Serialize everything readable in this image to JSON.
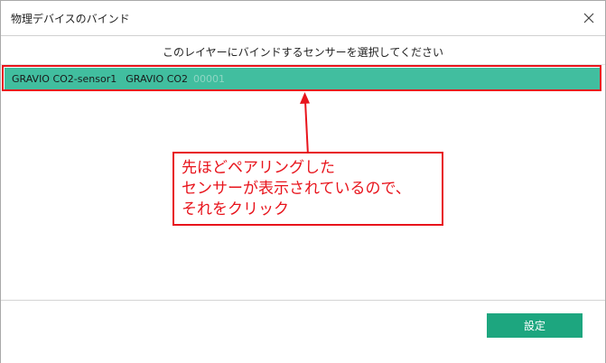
{
  "dialog": {
    "title": "物理デバイスのバインド",
    "instruction": "このレイヤーにバインドするセンサーを選択してください"
  },
  "sensor_list": {
    "items": [
      {
        "name": "GRAVIO CO2-sensor1",
        "type": "GRAVIO CO2",
        "extra": "00001"
      }
    ]
  },
  "annotation": {
    "lines": [
      "先ほどペアリングした",
      "センサーが表示されているので、",
      "それをクリック"
    ]
  },
  "footer": {
    "set_label": "設定"
  },
  "icons": {
    "close": "close-icon"
  },
  "colors": {
    "row_selected": "#41be9f",
    "button": "#1da67f",
    "annotation_red": "#e8141c"
  }
}
